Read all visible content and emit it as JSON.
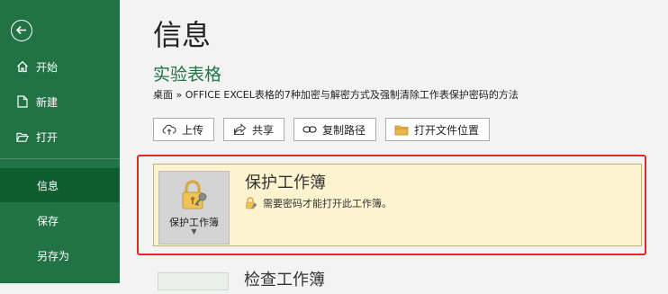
{
  "sidebar": {
    "back_icon": "back-arrow-icon",
    "items": [
      {
        "label": "开始",
        "icon": "home-icon"
      },
      {
        "label": "新建",
        "icon": "new-document-icon"
      },
      {
        "label": "打开",
        "icon": "open-folder-icon"
      },
      {
        "label": "信息",
        "active": true
      },
      {
        "label": "保存"
      },
      {
        "label": "另存为"
      }
    ]
  },
  "page": {
    "title": "信息",
    "document_name": "实验表格",
    "breadcrumb": "桌面 » OFFICE EXCEL表格的7种加密与解密方式及强制清除工作表保护密码的方法"
  },
  "toolbar": {
    "upload_label": "上传",
    "share_label": "共享",
    "copy_path_label": "复制路径",
    "open_location_label": "打开文件位置"
  },
  "protect": {
    "button_label": "保护工作簿",
    "title": "保护工作簿",
    "description": "需要密码才能打开此工作簿。"
  },
  "inspect": {
    "title": "检查工作簿"
  },
  "colors": {
    "sidebar_bg": "#217346",
    "sidebar_active": "#0e5c2f",
    "accent": "#217346",
    "highlight_border": "#e3262a",
    "card_bg": "#fdf3cf"
  }
}
